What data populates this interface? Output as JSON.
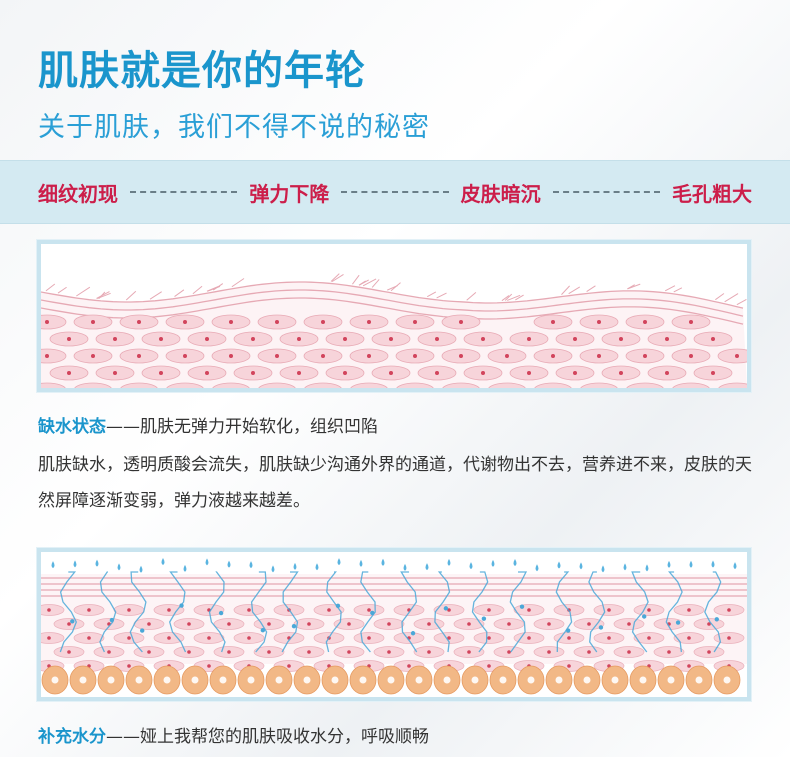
{
  "title": "肌肤就是你的年轮",
  "subtitle": "关于肌肤，我们不得不说的秘密",
  "stages": [
    "细纹初现",
    "弹力下降",
    "皮肤暗沉",
    "毛孔粗大"
  ],
  "section1": {
    "lead": "缺水状态",
    "sep": "——",
    "caption": "肌肤无弹力开始软化，组织凹陷",
    "body": "肌肤缺水，透明质酸会流失，肌肤缺少沟通外界的通道，代谢物出不去，营养进不来，皮肤的天然屏障逐渐变弱，弹力液越来越差。"
  },
  "section2": {
    "lead": "补充水分",
    "sep": "——",
    "caption": "娅上我帮您的肌肤吸收水分，呼吸顺畅"
  },
  "colors": {
    "title": "#1a95cc",
    "stage": "#cc1e4a",
    "band": "#d4eaf2",
    "cell": "#f7d4da",
    "nucleus": "#d2445c",
    "fiber": "#4aa8d8",
    "basal": "#f2b886"
  }
}
